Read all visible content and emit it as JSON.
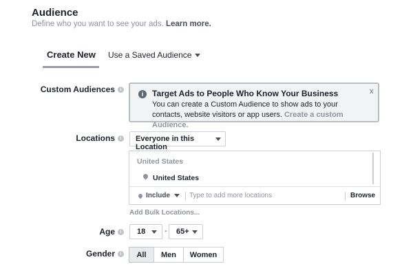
{
  "header": {
    "title": "Audience",
    "subtitle": "Define who you want to see your ads.",
    "learn_more": "Learn more."
  },
  "tabs": {
    "create_new": "Create New",
    "saved": "Use a Saved Audience"
  },
  "custom_audiences": {
    "label": "Custom Audiences",
    "info_icon": "info-icon",
    "notice_title": "Target Ads to People Who Know Your Business",
    "notice_body": "You can create a Custom Audience to show ads to your contacts, website visitors or app users.",
    "notice_link": "Create a custom Audience.",
    "close": "x"
  },
  "locations": {
    "label": "Locations",
    "scope": "Everyone in this Location",
    "group_header": "United States",
    "items": [
      "United States"
    ],
    "include": "Include",
    "input_placeholder": "Type to add more locations",
    "browse": "Browse",
    "bulk": "Add Bulk Locations..."
  },
  "age": {
    "label": "Age",
    "min": "18",
    "separator": "-",
    "max": "65+"
  },
  "gender": {
    "label": "Gender",
    "options": [
      "All",
      "Men",
      "Women"
    ],
    "selected": "All"
  },
  "colors": {
    "text": "#1d2129",
    "muted": "#90949c",
    "border": "#ccd0d5",
    "notice_bg": "#f2f3f5"
  }
}
